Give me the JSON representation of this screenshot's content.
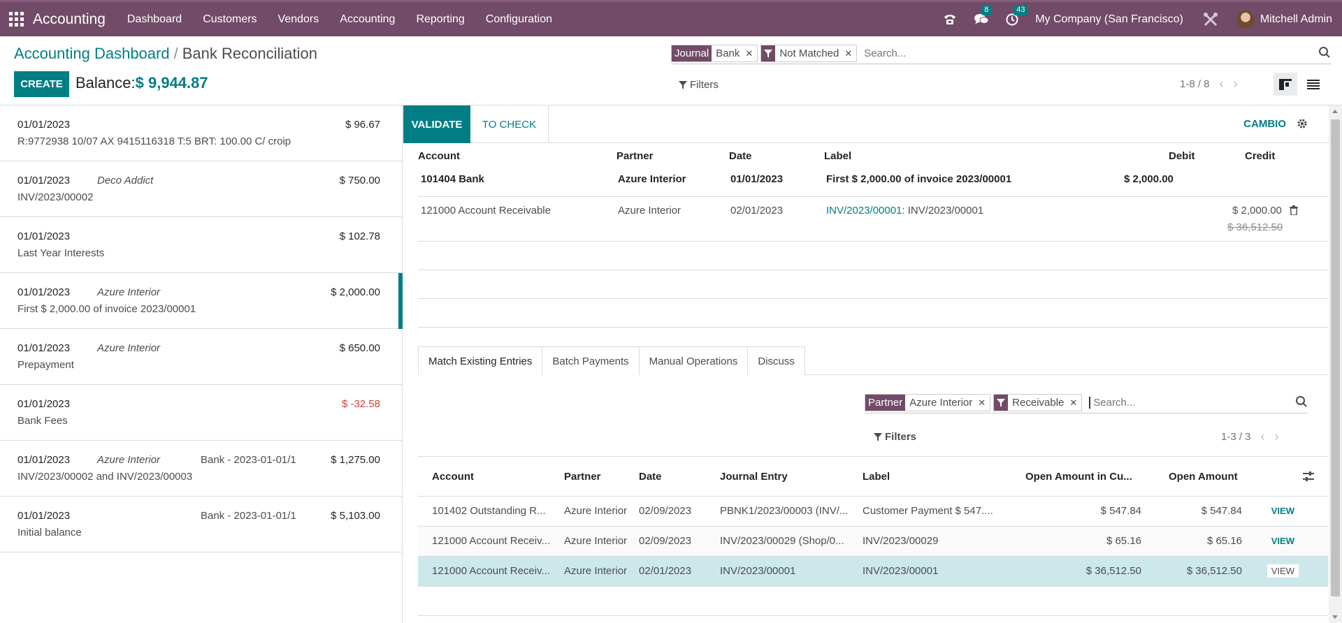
{
  "navbar": {
    "app_name": "Accounting",
    "menu": [
      "Dashboard",
      "Customers",
      "Vendors",
      "Accounting",
      "Reporting",
      "Configuration"
    ],
    "messages_badge": "8",
    "activities_badge": "43",
    "company": "My Company (San Francisco)",
    "user": "Mitchell Admin"
  },
  "control_panel": {
    "breadcrumb_parent": "Accounting Dashboard",
    "breadcrumb_separator": "/",
    "breadcrumb_current": "Bank Reconciliation",
    "create_label": "CREATE",
    "balance_label": "Balance:",
    "balance_value": "$ 9,944.87",
    "facets": [
      {
        "label": "Journal",
        "value": "Bank"
      },
      {
        "label": "",
        "value": "Not Matched",
        "icon": "filter-icon"
      }
    ],
    "search_placeholder": "Search...",
    "filters_label": "Filters",
    "pager": "1-8 / 8"
  },
  "statement_lines": [
    {
      "date": "01/01/2023",
      "partner": "",
      "ref": "",
      "amount": "$ 96.67",
      "label": "R:9772938 10/07 AX 9415116318 T:5 BRT: 100.00 C/ croip"
    },
    {
      "date": "01/01/2023",
      "partner": "Deco Addict",
      "ref": "",
      "amount": "$ 750.00",
      "label": "INV/2023/00002"
    },
    {
      "date": "01/01/2023",
      "partner": "",
      "ref": "",
      "amount": "$ 102.78",
      "label": "Last Year Interests"
    },
    {
      "date": "01/01/2023",
      "partner": "Azure Interior",
      "ref": "",
      "amount": "$ 2,000.00",
      "label": "First $ 2,000.00 of invoice 2023/00001",
      "active": true
    },
    {
      "date": "01/01/2023",
      "partner": "Azure Interior",
      "ref": "",
      "amount": "$ 650.00",
      "label": "Prepayment"
    },
    {
      "date": "01/01/2023",
      "partner": "",
      "ref": "",
      "amount": "$ -32.58",
      "label": "Bank Fees",
      "negative": true
    },
    {
      "date": "01/01/2023",
      "partner": "Azure Interior",
      "ref": "Bank - 2023-01-01/1",
      "amount": "$ 1,275.00",
      "label": "INV/2023/00002 and INV/2023/00003"
    },
    {
      "date": "01/01/2023",
      "partner": "",
      "ref": "Bank - 2023-01-01/1",
      "amount": "$ 5,103.00",
      "label": "Initial balance"
    }
  ],
  "reconcile": {
    "validate_label": "VALIDATE",
    "to_check_label": "TO CHECK",
    "cambio_label": "CAMBIO",
    "columns": {
      "account": "Account",
      "partner": "Partner",
      "date": "Date",
      "label": "Label",
      "debit": "Debit",
      "credit": "Credit"
    },
    "bank_line": {
      "account": "101404 Bank",
      "partner": "Azure Interior",
      "date": "01/01/2023",
      "label": "First $ 2,000.00 of invoice 2023/00001",
      "debit": "$ 2,000.00"
    },
    "counterpart": {
      "account": "121000 Account Receivable",
      "partner": "Azure Interior",
      "date": "02/01/2023",
      "label_link": "INV/2023/00001",
      "label_rest": ": INV/2023/00001",
      "credit": "$ 2,000.00",
      "credit_original": "$ 36,512.50"
    }
  },
  "tabs": [
    "Match Existing Entries",
    "Batch Payments",
    "Manual Operations",
    "Discuss"
  ],
  "match": {
    "facets": [
      {
        "label": "Partner",
        "value": "Azure Interior"
      },
      {
        "label": "",
        "value": "Receivable",
        "icon": "filter-icon"
      }
    ],
    "search_placeholder": "Search...",
    "filters_label": "Filters",
    "pager": "1-3 / 3",
    "columns": {
      "account": "Account",
      "partner": "Partner",
      "date": "Date",
      "journal_entry": "Journal Entry",
      "label": "Label",
      "open_amount_cur": "Open Amount in Cu...",
      "open_amount": "Open Amount"
    },
    "rows": [
      {
        "account": "101402 Outstanding R...",
        "partner": "Azure Interior",
        "date": "02/09/2023",
        "journal_entry": "PBNK1/2023/00003 (INV/...",
        "label": "Customer Payment $ 547....",
        "open_amount_cur": "$ 547.84",
        "open_amount": "$ 547.84",
        "view": "VIEW"
      },
      {
        "account": "121000 Account Receiv...",
        "partner": "Azure Interior",
        "date": "02/09/2023",
        "journal_entry": "INV/2023/00029 (Shop/0...",
        "label": "INV/2023/00029",
        "open_amount_cur": "$ 65.16",
        "open_amount": "$ 65.16",
        "view": "VIEW"
      },
      {
        "account": "121000 Account Receiv...",
        "partner": "Azure Interior",
        "date": "02/01/2023",
        "journal_entry": "INV/2023/00001",
        "label": "INV/2023/00001",
        "open_amount_cur": "$ 36,512.50",
        "open_amount": "$ 36,512.50",
        "view": "VIEW",
        "selected": true
      }
    ]
  },
  "colors": {
    "brand": "#714b67",
    "accent": "#017e84",
    "negative": "#d23f3a"
  }
}
